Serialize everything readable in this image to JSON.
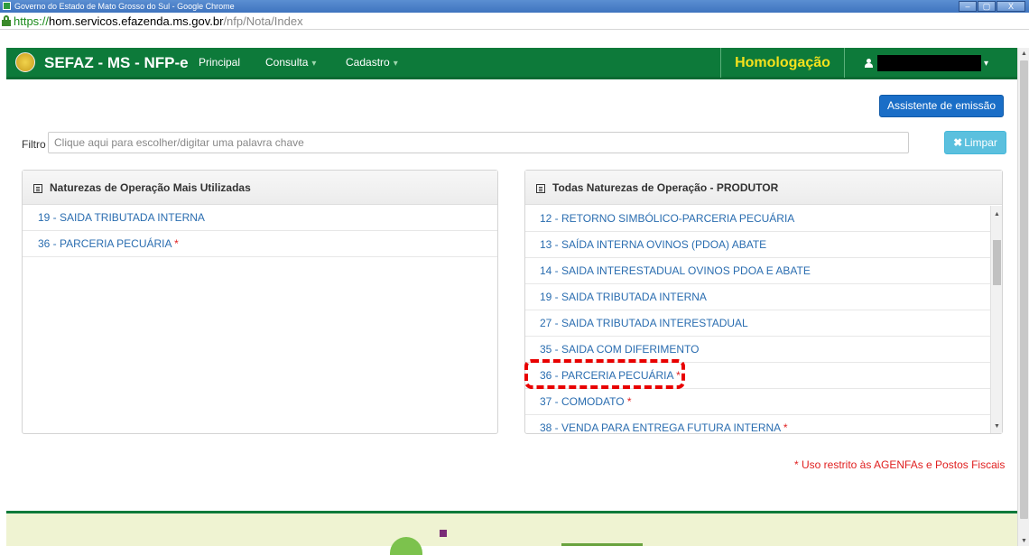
{
  "window": {
    "title": "Governo do Estado de Mato Grosso do Sul - Google Chrome",
    "controls": [
      "–",
      "▢",
      "X"
    ]
  },
  "address_bar": {
    "scheme": "https://",
    "host": "hom.servicos.efazenda.ms.gov.br",
    "path": "/nfp/Nota/Index"
  },
  "navbar": {
    "brand": "SEFAZ - MS - NFP-e",
    "menu": [
      {
        "label": "Principal",
        "has_caret": false
      },
      {
        "label": "Consulta",
        "has_caret": true
      },
      {
        "label": "Cadastro",
        "has_caret": true
      }
    ],
    "environment": "Homologação"
  },
  "toolbar": {
    "assist_button": "Assistente de emissão"
  },
  "filter": {
    "label": "Filtro",
    "placeholder": "Clique aqui para escolher/digitar uma palavra chave",
    "clear_button": "Limpar"
  },
  "panel_left": {
    "title": "Naturezas de Operação Mais Utilizadas",
    "items": [
      {
        "label": "19 - SAIDA TRIBUTADA INTERNA",
        "restricted": ""
      },
      {
        "label": "36 - PARCERIA PECUÁRIA",
        "restricted": "*"
      }
    ]
  },
  "panel_right": {
    "title": "Todas Naturezas de Operação - PRODUTOR",
    "items": [
      {
        "label": "12 - RETORNO SIMBÓLICO-PARCERIA PECUÁRIA",
        "restricted": ""
      },
      {
        "label": "13 - SAÍDA INTERNA OVINOS (PDOA) ABATE",
        "restricted": ""
      },
      {
        "label": "14 - SAIDA INTERESTADUAL OVINOS PDOA E ABATE",
        "restricted": ""
      },
      {
        "label": "19 - SAIDA TRIBUTADA INTERNA",
        "restricted": ""
      },
      {
        "label": "27 - SAIDA TRIBUTADA INTERESTADUAL",
        "restricted": ""
      },
      {
        "label": "35 - SAIDA COM DIFERIMENTO",
        "restricted": ""
      },
      {
        "label": "36 - PARCERIA PECUÁRIA",
        "restricted": "*"
      },
      {
        "label": "37 - COMODATO",
        "restricted": "*"
      },
      {
        "label": "38 - VENDA PARA ENTREGA FUTURA INTERNA",
        "restricted": "*"
      }
    ]
  },
  "notice": "* Uso restrito às AGENFAs e Postos Fiscais",
  "colors": {
    "navbar_green": "#0d7a3a",
    "environment_yellow": "#f5e11c",
    "link_blue": "#2a6db0",
    "primary_button": "#1a6ec7",
    "info_button": "#5bc0de",
    "restricted_red": "#e02020",
    "highlight_red": "#e80000"
  }
}
